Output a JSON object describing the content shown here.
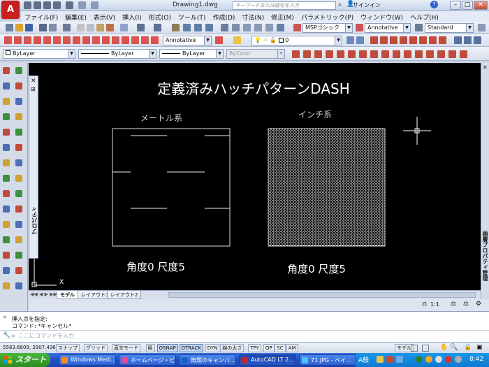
{
  "app": {
    "logo_letter": "A",
    "doc_title": "Drawing1.dwg",
    "search_placeholder": "キーワードまたは語句を入力",
    "signin": "サインイン"
  },
  "menu": [
    "ファイル(F)",
    "編集(E)",
    "表示(V)",
    "挿入(I)",
    "形式(O)",
    "ツール(T)",
    "作成(D)",
    "寸法(N)",
    "修正(M)",
    "パラメトリック(P)",
    "ウィンドウ(W)",
    "ヘルプ(H)"
  ],
  "toolbar": {
    "text_style": "MSPゴシック",
    "dim_style": "Annotative",
    "table_style": "Standard",
    "multileader_style": "Annotative",
    "layer": "0",
    "color": "ByLayer",
    "linetype": "ByLayer",
    "lineweight": "ByLayer",
    "plotstyle": "ByColor"
  },
  "palettes": {
    "properties_label": "プロパティ",
    "right_label": "画層プロパティ管理"
  },
  "drawing": {
    "title": "定義済みハッチパターンDASH",
    "left_label": "メートル系",
    "right_label": "インチ系",
    "left_caption": "角度0  尺度5",
    "right_caption": "角度0  尺度5",
    "ucs_x": "X",
    "ucs_y": "Y"
  },
  "tabs": {
    "model": "モデル",
    "layout1": "レイアウト1",
    "layout2": "レイアウト2"
  },
  "annotation_scale": "1:1",
  "command": {
    "line1": "挿入点を指定:",
    "line2": "コマンド: *キャンセル*",
    "prompt": "ここにコマンドを入力"
  },
  "status": {
    "coords": "5583.6809, 3907.4363, 0.0000",
    "buttons": [
      "スナップ",
      "グリッド",
      "直交モード",
      "極",
      "OSNAP",
      "OTRACK",
      "DYN",
      "線の太さ",
      "TPY",
      "QP",
      "SC",
      "AM"
    ],
    "active": [
      "OSNAP",
      "OTRACK"
    ],
    "model_label": "モデル"
  },
  "taskbar": {
    "start": "スタート",
    "items": [
      "Windows Medi...",
      "ホームページ・ビ...",
      "無題のキャンバ...",
      "AutoCAD LT 2...",
      "71.JPG - ペイ..."
    ],
    "ime": "A般",
    "clock": "8:42"
  }
}
